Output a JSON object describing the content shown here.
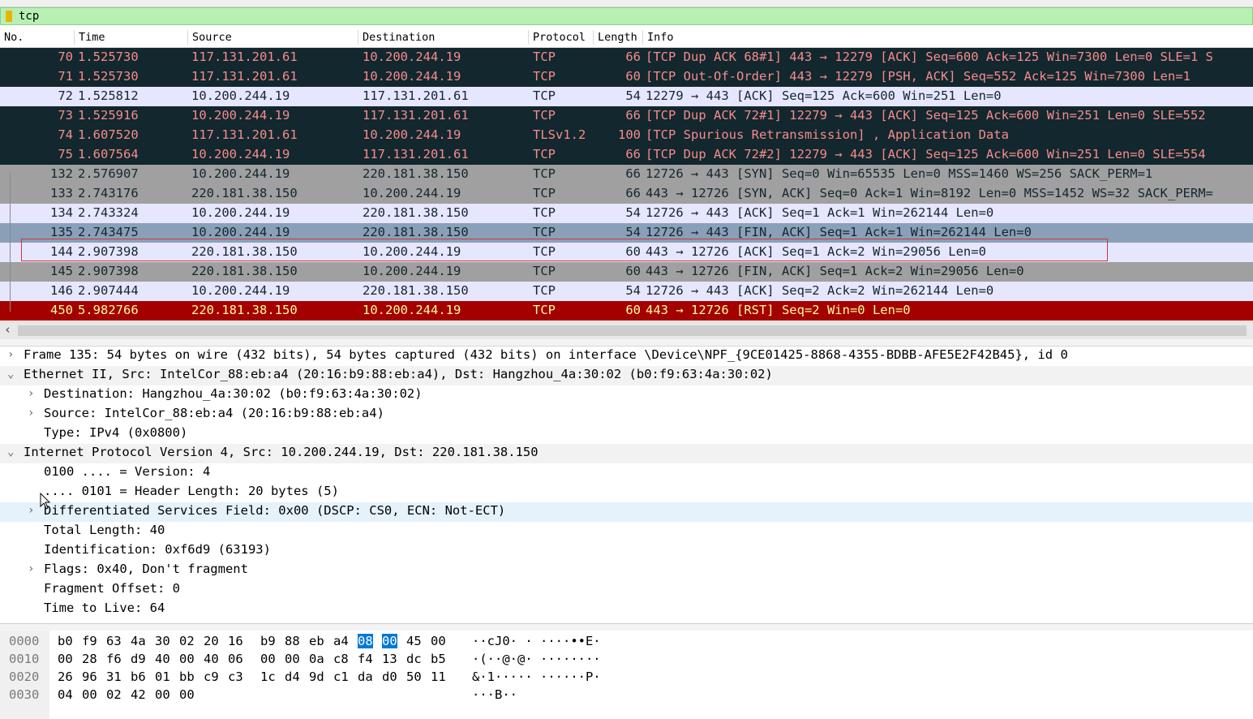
{
  "filter": {
    "text": "tcp"
  },
  "columns": [
    "No.",
    "Time",
    "Source",
    "Destination",
    "Protocol",
    "Length",
    "Info"
  ],
  "packets": [
    {
      "no": "70",
      "time": "1.525730",
      "src": "117.131.201.61",
      "dst": "10.200.244.19",
      "proto": "TCP",
      "len": "66",
      "info": "[TCP Dup ACK 68#1] 443 → 12279 [ACK] Seq=600 Ack=125 Win=7300 Len=0 SLE=1 S",
      "bg": "#12272e",
      "fg": "#f78b8b"
    },
    {
      "no": "71",
      "time": "1.525730",
      "src": "117.131.201.61",
      "dst": "10.200.244.19",
      "proto": "TCP",
      "len": "60",
      "info": "[TCP Out-Of-Order] 443 → 12279 [PSH, ACK] Seq=552 Ack=125 Win=7300 Len=1",
      "bg": "#12272e",
      "fg": "#f78b8b"
    },
    {
      "no": "72",
      "time": "1.525812",
      "src": "10.200.244.19",
      "dst": "117.131.201.61",
      "proto": "TCP",
      "len": "54",
      "info": "12279 → 443 [ACK] Seq=125 Ack=600 Win=251 Len=0",
      "bg": "#e7e6ff",
      "fg": "#12272e"
    },
    {
      "no": "73",
      "time": "1.525916",
      "src": "10.200.244.19",
      "dst": "117.131.201.61",
      "proto": "TCP",
      "len": "66",
      "info": "[TCP Dup ACK 72#1] 12279 → 443 [ACK] Seq=125 Ack=600 Win=251 Len=0 SLE=552",
      "bg": "#12272e",
      "fg": "#f78b8b"
    },
    {
      "no": "74",
      "time": "1.607520",
      "src": "117.131.201.61",
      "dst": "10.200.244.19",
      "proto": "TLSv1.2",
      "len": "100",
      "info": "[TCP Spurious Retransmission] , Application Data",
      "bg": "#12272e",
      "fg": "#f78b8b"
    },
    {
      "no": "75",
      "time": "1.607564",
      "src": "10.200.244.19",
      "dst": "117.131.201.61",
      "proto": "TCP",
      "len": "66",
      "info": "[TCP Dup ACK 72#2] 12279 → 443 [ACK] Seq=125 Ack=600 Win=251 Len=0 SLE=554",
      "bg": "#12272e",
      "fg": "#f78b8b"
    },
    {
      "no": "132",
      "time": "2.576907",
      "src": "10.200.244.19",
      "dst": "220.181.38.150",
      "proto": "TCP",
      "len": "66",
      "info": "12726 → 443 [SYN] Seq=0 Win=65535 Len=0 MSS=1460 WS=256 SACK_PERM=1",
      "bg": "#a0a0a0",
      "fg": "#12272e"
    },
    {
      "no": "133",
      "time": "2.743176",
      "src": "220.181.38.150",
      "dst": "10.200.244.19",
      "proto": "TCP",
      "len": "66",
      "info": "443 → 12726 [SYN, ACK] Seq=0 Ack=1 Win=8192 Len=0 MSS=1452 WS=32 SACK_PERM=",
      "bg": "#a0a0a0",
      "fg": "#12272e"
    },
    {
      "no": "134",
      "time": "2.743324",
      "src": "10.200.244.19",
      "dst": "220.181.38.150",
      "proto": "TCP",
      "len": "54",
      "info": "12726 → 443 [ACK] Seq=1 Ack=1 Win=262144 Len=0",
      "bg": "#e7e6ff",
      "fg": "#12272e"
    },
    {
      "no": "135",
      "time": "2.743475",
      "src": "10.200.244.19",
      "dst": "220.181.38.150",
      "proto": "TCP",
      "len": "54",
      "info": "12726 → 443 [FIN, ACK] Seq=1 Ack=1 Win=262144 Len=0",
      "bg": "#8aa0b8",
      "fg": "#12272e"
    },
    {
      "no": "144",
      "time": "2.907398",
      "src": "220.181.38.150",
      "dst": "10.200.244.19",
      "proto": "TCP",
      "len": "60",
      "info": "443 → 12726 [ACK] Seq=1 Ack=2 Win=29056 Len=0",
      "bg": "#e7e6ff",
      "fg": "#12272e"
    },
    {
      "no": "145",
      "time": "2.907398",
      "src": "220.181.38.150",
      "dst": "10.200.244.19",
      "proto": "TCP",
      "len": "60",
      "info": "443 → 12726 [FIN, ACK] Seq=1 Ack=2 Win=29056 Len=0",
      "bg": "#a0a0a0",
      "fg": "#12272e"
    },
    {
      "no": "146",
      "time": "2.907444",
      "src": "10.200.244.19",
      "dst": "220.181.38.150",
      "proto": "TCP",
      "len": "54",
      "info": "12726 → 443 [ACK] Seq=2 Ack=2 Win=262144 Len=0",
      "bg": "#e7e6ff",
      "fg": "#12272e"
    },
    {
      "no": "450",
      "time": "5.982766",
      "src": "220.181.38.150",
      "dst": "10.200.244.19",
      "proto": "TCP",
      "len": "60",
      "info": "443 → 12726 [RST] Seq=2 Win=0 Len=0",
      "bg": "#a40000",
      "fg": "#fffc9c"
    }
  ],
  "details": [
    {
      "text": "Frame 135: 54 bytes on wire (432 bits), 54 bytes captured (432 bits) on interface \\Device\\NPF_{9CE01425-8868-4355-BDBB-AFE5E2F42B45}, id 0",
      "indent": 0,
      "arrow": "›",
      "bg": "#ffffff"
    },
    {
      "text": "Ethernet II, Src: IntelCor_88:eb:a4 (20:16:b9:88:eb:a4), Dst: Hangzhou_4a:30:02 (b0:f9:63:4a:30:02)",
      "indent": 0,
      "arrow": "⌄",
      "bg": "#f2f2f2"
    },
    {
      "text": "Destination: Hangzhou_4a:30:02 (b0:f9:63:4a:30:02)",
      "indent": 1,
      "arrow": "›",
      "bg": "#ffffff"
    },
    {
      "text": "Source: IntelCor_88:eb:a4 (20:16:b9:88:eb:a4)",
      "indent": 1,
      "arrow": "›",
      "bg": "#ffffff"
    },
    {
      "text": "Type: IPv4 (0x0800)",
      "indent": 1,
      "arrow": "",
      "bg": "#ffffff"
    },
    {
      "text": "Internet Protocol Version 4, Src: 10.200.244.19, Dst: 220.181.38.150",
      "indent": 0,
      "arrow": "⌄",
      "bg": "#f2f2f2"
    },
    {
      "text": "0100 .... = Version: 4",
      "indent": 1,
      "arrow": "",
      "bg": "#ffffff"
    },
    {
      "text": ".... 0101 = Header Length: 20 bytes (5)",
      "indent": 1,
      "arrow": "",
      "bg": "#ffffff"
    },
    {
      "text": "Differentiated Services Field: 0x00 (DSCP: CS0, ECN: Not-ECT)",
      "indent": 1,
      "arrow": "›",
      "bg": "#e5f1fb"
    },
    {
      "text": "Total Length: 40",
      "indent": 1,
      "arrow": "",
      "bg": "#ffffff"
    },
    {
      "text": "Identification: 0xf6d9 (63193)",
      "indent": 1,
      "arrow": "",
      "bg": "#ffffff"
    },
    {
      "text": "Flags: 0x40, Don't fragment",
      "indent": 1,
      "arrow": "›",
      "bg": "#ffffff"
    },
    {
      "text": "Fragment Offset: 0",
      "indent": 1,
      "arrow": "",
      "bg": "#ffffff"
    },
    {
      "text": "Time to Live: 64",
      "indent": 1,
      "arrow": "",
      "bg": "#ffffff"
    }
  ],
  "hex": [
    {
      "offset": "0000",
      "bytes": [
        "b0",
        "f9",
        "63",
        "4a",
        "30",
        "02",
        "20",
        "16",
        "b9",
        "88",
        "eb",
        "a4",
        "08",
        "00",
        "45",
        "00"
      ],
      "ascii": "··cJ0· · ····••E·",
      "hl": [
        12,
        13
      ]
    },
    {
      "offset": "0010",
      "bytes": [
        "00",
        "28",
        "f6",
        "d9",
        "40",
        "00",
        "40",
        "06",
        "00",
        "00",
        "0a",
        "c8",
        "f4",
        "13",
        "dc",
        "b5"
      ],
      "ascii": "·(··@·@· ········",
      "hl": []
    },
    {
      "offset": "0020",
      "bytes": [
        "26",
        "96",
        "31",
        "b6",
        "01",
        "bb",
        "c9",
        "c3",
        "1c",
        "d4",
        "9d",
        "c1",
        "da",
        "d0",
        "50",
        "11"
      ],
      "ascii": "&·1····· ······P·",
      "hl": []
    },
    {
      "offset": "0030",
      "bytes": [
        "04",
        "00",
        "02",
        "42",
        "00",
        "00"
      ],
      "ascii": "···B··",
      "hl": []
    }
  ]
}
